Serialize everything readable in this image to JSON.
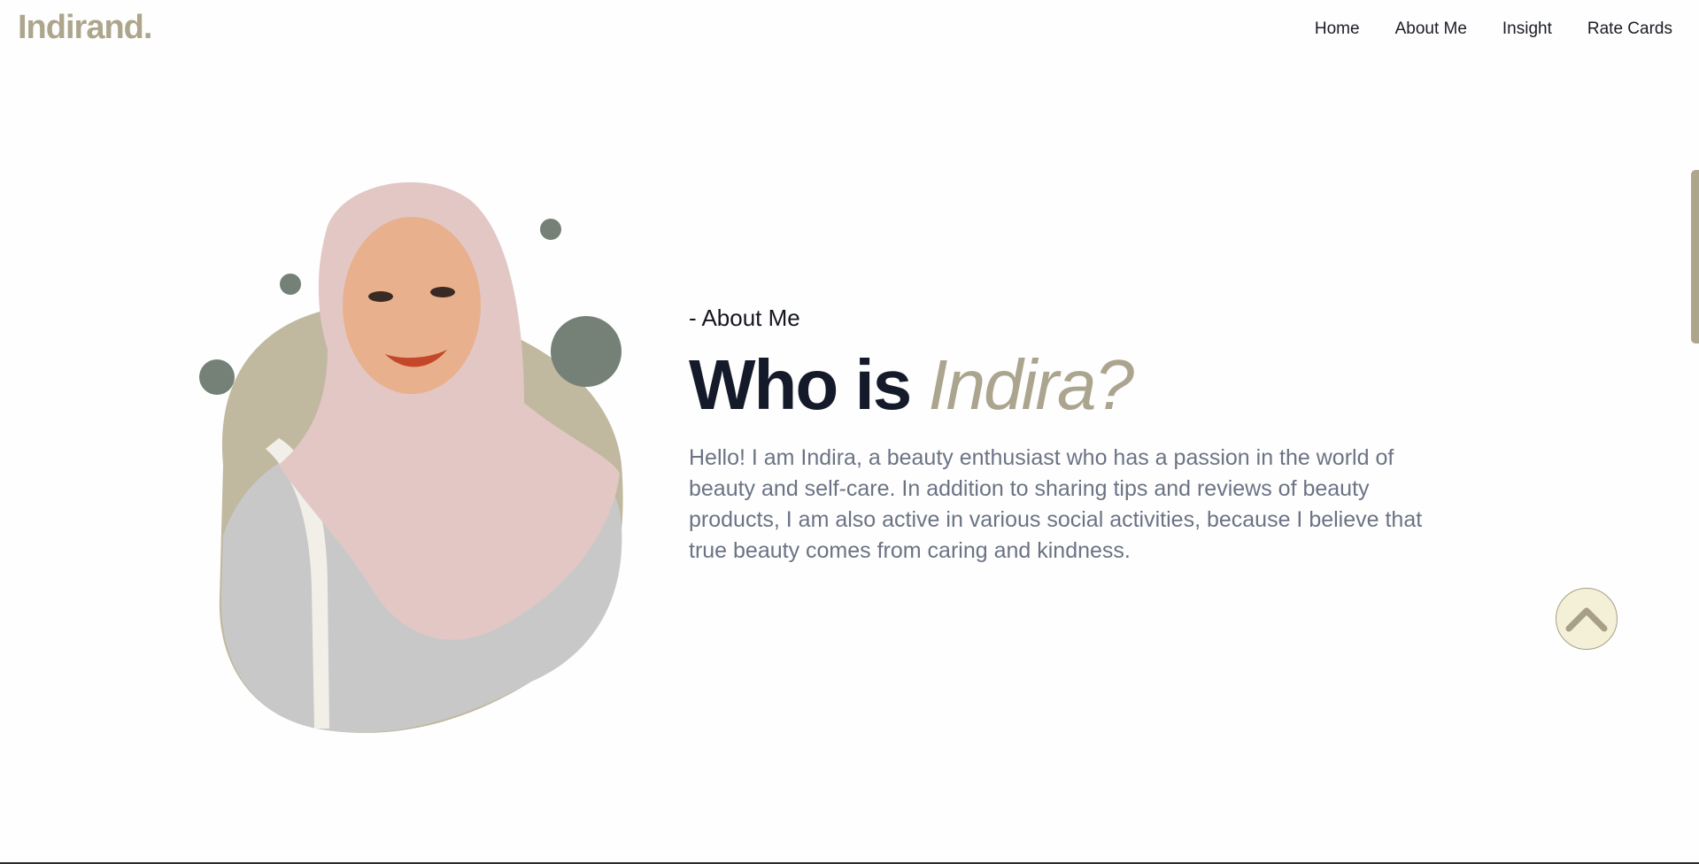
{
  "brand": {
    "logo": "Indirand."
  },
  "nav": {
    "items": [
      {
        "label": "Home"
      },
      {
        "label": "About Me"
      },
      {
        "label": "Insight"
      },
      {
        "label": "Rate Cards"
      }
    ]
  },
  "about": {
    "eyebrow": "- About Me",
    "heading_main": "Who is",
    "heading_accent": "Indira?",
    "description": "Hello! I am Indira, a beauty enthusiast who has a passion in the world of beauty and self-care. In addition to sharing tips and reviews of beauty products, I am also active in various social activities, because I believe that true beauty comes from caring and kindness."
  },
  "colors": {
    "brand": "#ada58c",
    "blob": "#c0b9a0",
    "dots": "#758077",
    "text_dark": "#141a2a",
    "text_muted": "#6b7384",
    "back_to_top_bg": "#f3f0d7"
  },
  "icons": {
    "back_to_top": "chevron-up-icon"
  }
}
